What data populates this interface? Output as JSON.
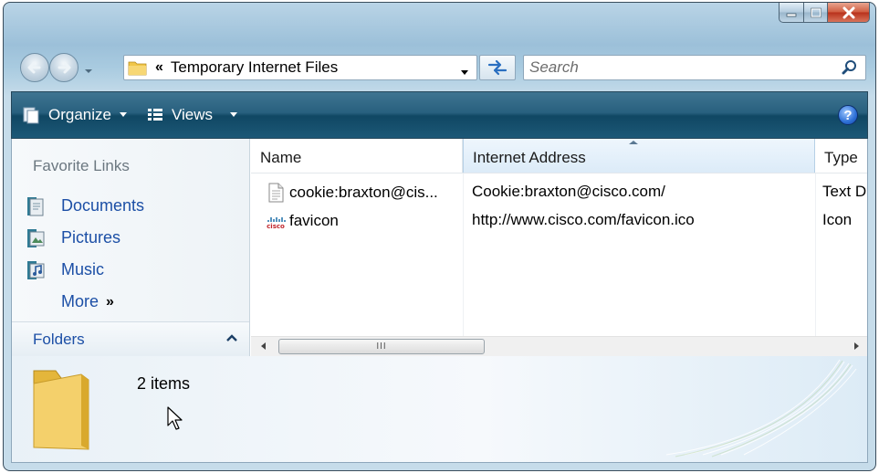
{
  "window": {
    "caption_buttons": [
      "minimize-icon",
      "maximize-icon",
      "close-icon"
    ],
    "accent_color": "#1c5877"
  },
  "address": {
    "chevrons": "«",
    "location": "Temporary Internet Files"
  },
  "search": {
    "placeholder": "Search"
  },
  "toolbar": {
    "organize_label": "Organize",
    "views_label": "Views",
    "help_label": "?"
  },
  "nav_pane": {
    "favorites_title": "Favorite Links",
    "items": [
      {
        "label": "Documents",
        "icon": "documents-icon"
      },
      {
        "label": "Pictures",
        "icon": "pictures-icon"
      },
      {
        "label": "Music",
        "icon": "music-icon"
      }
    ],
    "more_label": "More",
    "more_chevron": "»",
    "folders_label": "Folders"
  },
  "file_list": {
    "columns": [
      "Name",
      "Internet Address",
      "Type"
    ],
    "rows": [
      {
        "name": "cookie:braxton@cis...",
        "address": "Cookie:braxton@cisco.com/",
        "type": "Text D",
        "icon": "text-document-icon"
      },
      {
        "name": "favicon",
        "address": "http://www.cisco.com/favicon.ico",
        "type": "Icon",
        "icon": "cisco-icon"
      }
    ],
    "scroll_thumb_grip": "III"
  },
  "details": {
    "item_count": "2 items"
  }
}
